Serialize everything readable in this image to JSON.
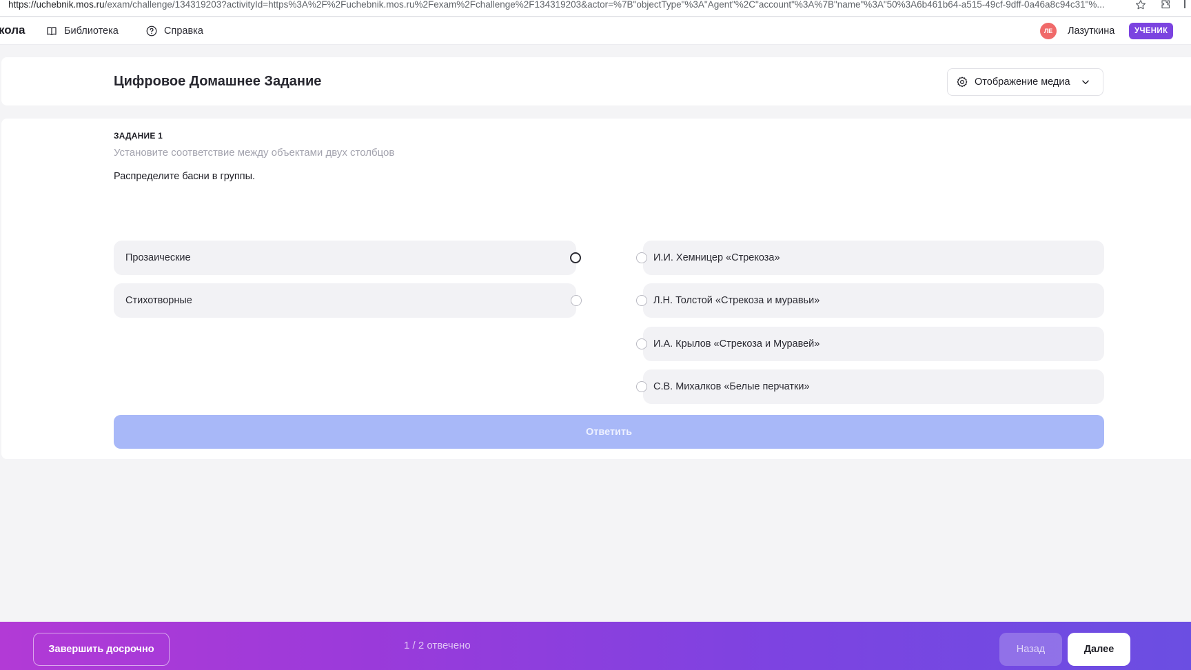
{
  "browser": {
    "url_host": "https://uchebnik.mos.ru",
    "url_rest": "/exam/challenge/134319203?activityId=https%3A%2F%2Fuchebnik.mos.ru%2Fexam%2Fchallenge%2F134319203&actor=%7B\"objectType\"%3A\"Agent\"%2C\"account\"%3A%7B\"name\"%3A\"50%3A6b461b64-a515-49cf-9dff-0a46a8c94c31\"%...",
    "left_edge_char": "l"
  },
  "header": {
    "brand": "кола",
    "nav": [
      {
        "label": "Библиотека",
        "icon": "book-icon"
      },
      {
        "label": "Справка",
        "icon": "help-icon"
      }
    ],
    "avatar_initials": "ЛЕ",
    "username": "Лазуткина",
    "role": "УЧЕНИК"
  },
  "page": {
    "title": "Цифровое Домашнее Задание",
    "media_button": "Отображение медиа"
  },
  "task": {
    "label": "ЗАДАНИЕ 1",
    "hint": "Установите соответствие между объектами двух столбцов",
    "question": "Распределите басни в группы.",
    "left_items": [
      "Прозаические",
      "Стихотворные"
    ],
    "right_items": [
      "И.И. Хемницер «Стрекоза»",
      "Л.Н. Толстой «Стрекоза и муравьи»",
      "И.А. Крылов «Стрекоза и Муравей»",
      "С.В. Михалков «Белые перчатки»"
    ],
    "answer_button": "Ответить"
  },
  "footer": {
    "finish_button": "Завершить досрочно",
    "progress": "1 / 2 отвечено",
    "back_button": "Назад",
    "next_button": "Далее"
  },
  "colors": {
    "accent": "#7b43e0",
    "answer_disabled": "#a8b8f8",
    "gradient_start": "#b23ad6",
    "gradient_end": "#6b4ee2",
    "avatar": "#f06a6a"
  }
}
